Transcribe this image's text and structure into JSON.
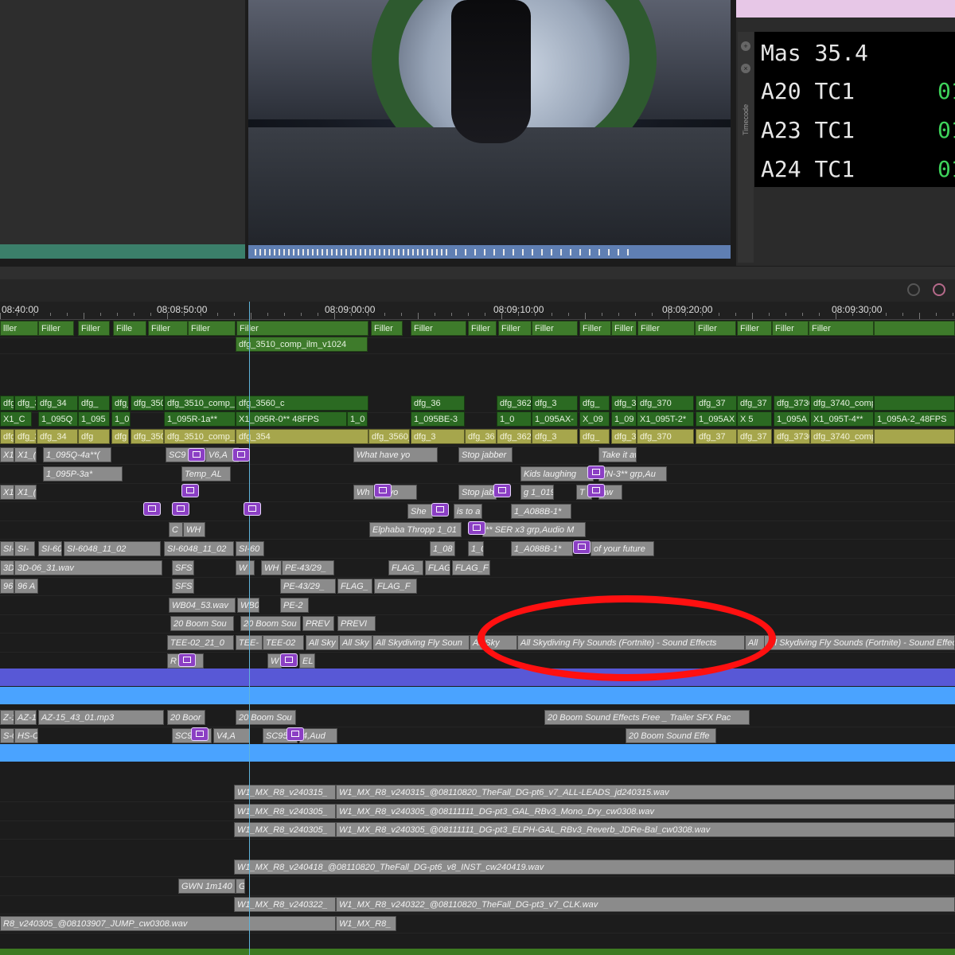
{
  "timecode": {
    "rows": [
      {
        "track": "Mas",
        "value": "35.4",
        "tc": ""
      },
      {
        "track": "A20",
        "value": "TC1",
        "tc": "01"
      },
      {
        "track": "A23",
        "value": "TC1",
        "tc": "01"
      },
      {
        "track": "A24",
        "value": "TC1",
        "tc": "01"
      }
    ],
    "panel_label": "Timecode"
  },
  "ruler": {
    "ticks": [
      "08:40:00",
      "08:08:50:00",
      "08:09:00:00",
      "08:09:10:00",
      "08:09:20:00",
      "08:09:30:00"
    ]
  },
  "tracks": {
    "v_filler": [
      "lller",
      "Filler",
      "Filler",
      "Fille",
      "Filler",
      "Filler",
      "Filler",
      "Filler",
      "Filler",
      "Filler",
      "Filler",
      "Filler",
      "Filler",
      "Filler",
      "Filler",
      "Filler",
      "Filler",
      "Filler",
      "Filler"
    ],
    "v_comp_top": "dfg_3510_comp_ilm_v1024",
    "v_main": [
      "dfg_",
      "dfg_346",
      "dfg_34",
      "dfg_",
      "dfg_",
      "dfg_3500_com",
      "dfg_3510_comp_ilm_v1023",
      "dfg_3560_c",
      "dfg_36",
      "dfg_3620",
      "dfg_3",
      "dfg_",
      "dfg_3680_c",
      "dfg_370",
      "dfg_37",
      "dfg_37",
      "dfg_3730_co",
      "dfg_3740_comp_"
    ],
    "v_src": [
      "X1_C",
      "1_095Q",
      "1_095",
      "1_0",
      "1_095R-1a**",
      "X1_095R-0** 48FPS",
      "1_0",
      "1_095BE-3",
      "1_0",
      "1_095AX-",
      "X_09",
      "1_09",
      "X1_095T-2*",
      "1_095AX",
      "X 5",
      "1_095A",
      "X1_095T-4**",
      "1_095A-2_48FPS"
    ],
    "v_lime": [
      "dfg_",
      "dfg_346",
      "dfg_34",
      "dfg",
      "dfg",
      "dfg_3500_com",
      "dfg_3510_comp_ilm_v1023",
      "dfg_354",
      "dfg_3560_c",
      "dfg_3",
      "dfg_36",
      "dfg_3620",
      "dfg_3",
      "dfg_",
      "dfg_3680_c",
      "dfg_370",
      "dfg_37",
      "dfg_37",
      "dfg_3730_co",
      "dfg_3740_comp_"
    ],
    "a1": [
      "X1_",
      "X1_(",
      "1_095Q-4a**(",
      "SC9",
      "V6,A",
      "What have yo",
      "Stop jabber",
      "Take it aw"
    ],
    "a2": [
      "1_095P-3a*",
      "Temp_AL",
      "Kids laughing",
      "7N-3** grp,Au"
    ],
    "a3": [
      "X1_",
      "X1_(",
      "Wh",
      "ye yo",
      "Stop jab",
      "g 1_019",
      "T",
      "aw"
    ],
    "a4": [
      "She",
      "is to a",
      "1_A088B-1*"
    ],
    "a5": [
      "C",
      "WH",
      "Elphaba Thropp 1_01",
      "** SER x3 grp,Audio M"
    ],
    "a6": [
      "SI-",
      "SI-",
      "SI-60",
      "SI-6048_11_02",
      "SI-6048_11_02",
      "SI-60",
      "1_08",
      "1_0",
      "1_A088B-1*",
      "of your future"
    ],
    "a7": [
      "3D",
      "3D-06_31.wav",
      "SFS",
      "W",
      "WH",
      "PE-43/29_",
      "FLAG_",
      "FLAG",
      "FLAG_F"
    ],
    "a8": [
      "96",
      "96 A",
      "SFS",
      "PE-43/29_",
      "FLAG_",
      "FLAG_F"
    ],
    "a9": [
      "WB04_53.wav",
      "WB0",
      "PE-2"
    ],
    "a10": [
      "20 Boom Sou",
      "20 Boom Sou",
      "PREV",
      "PREVI"
    ],
    "a11": [
      "TEE-02_21_0",
      "TEE-",
      "TEE-02",
      "All Sky",
      "All Sky",
      "All Skydiving Fly Soun",
      "All Sky",
      "All Skydiving Fly Sounds (Fortnite) - Sound Effects",
      "All",
      "All Skydiving Fly Sounds (Fortnite) - Sound Effec"
    ],
    "a12": [
      "R",
      "W",
      "EL"
    ],
    "a13": [
      "Z-1",
      "AZ-1",
      "AZ-15_43_01.mp3",
      "20 Boor",
      "20 Boom Sou",
      "20 Boom Sound Effects Free _ Trailer SFX Pac"
    ],
    "a14": [
      "S-0",
      "HS-C",
      "SC9",
      "V4,A",
      "SC95",
      "4,Aud",
      "20 Boom Sound Effe"
    ],
    "m1": [
      "W1_MX_R8_v240315_",
      "W1_MX_R8_v240315_@08110820_TheFall_DG-pt6_v7_ALL-LEADS_jd240315.wav"
    ],
    "m2": [
      "W1_MX_R8_v240305_",
      "W1_MX_R8_v240305_@08111111_DG-pt3_GAL_RBv3_Mono_Dry_cw0308.wav"
    ],
    "m3": [
      "W1_MX_R8_v240305_",
      "W1_MX_R8_v240305_@08111111_DG-pt3_ELPH-GAL_RBv3_Reverb_JDRe-Bal_cw0308.wav"
    ],
    "m4": [
      "W1_MX_R8_v240418_@08110820_TheFall_DG-pt6_v8_INST_cw240419.wav"
    ],
    "m5": [
      "GWN 1m140",
      "G"
    ],
    "m6": [
      "W1_MX_R8_v240322_",
      "W1_MX_R8_v240322_@08110820_TheFall_DG-pt3_v7_CLK.wav"
    ],
    "m7": [
      "R8_v240305_@08103907_JUMP_cw0308.wav",
      "W1_MX_R8_"
    ]
  },
  "colors": {
    "highlight": "#ff1010",
    "video_clip": "#3e7b2b",
    "audio_clip": "#8b8b8b",
    "timecode_green": "#3ed35b"
  }
}
